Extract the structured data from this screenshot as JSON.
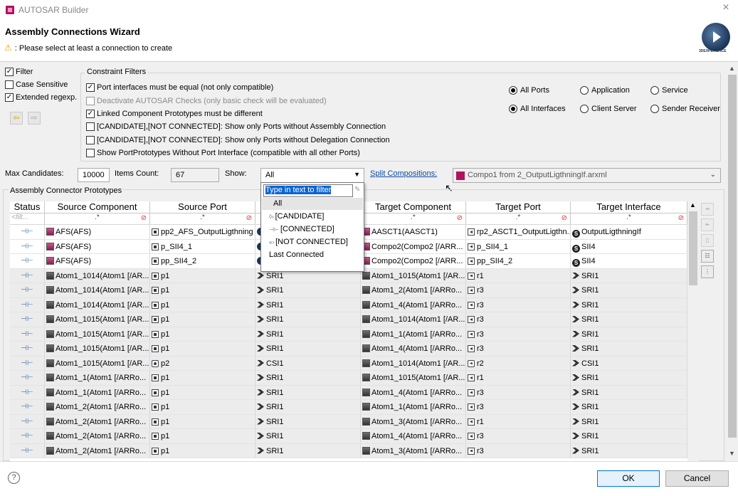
{
  "window": {
    "title": "AUTOSAR Builder",
    "close": "×"
  },
  "wizard": {
    "title": "Assembly Connections Wizard",
    "message": ": Please select at least a connection to create"
  },
  "brand": {
    "logo_text": "3DEXPERIENCE"
  },
  "left_options": {
    "filter": "Filter",
    "case_sensitive": "Case Sensitive",
    "extended_regexp": "Extended regexp."
  },
  "constraints": {
    "group_label": "Constraint Filters",
    "items": [
      "Port interfaces must be equal (not only compatible)",
      "Deactivate AUTOSAR Checks (only basic check will be evaluated)",
      "Linked Component Prototypes must be different",
      "[CANDIDATE],[NOT CONNECTED]: Show only Ports without Assembly Connection",
      "[CANDIDATE],[NOT CONNECTED]: Show only Ports without Delegation Connection",
      "Show PortPrototypes Without Port Interface (compatible with all other Ports)"
    ],
    "ports_radios": [
      "All Ports",
      "Application",
      "Service"
    ],
    "interfaces_radios": [
      "All Interfaces",
      "Client Server",
      "Sender Receiver"
    ]
  },
  "controls": {
    "max_candidates_label": "Max Candidates:",
    "max_candidates_value": "10000",
    "items_count_label": "Items Count:",
    "items_count_value": "67",
    "show_label": "Show:",
    "show_value": "All",
    "split_link": "Split Compositions:",
    "composition_value": "Compo1 from 2_OutputLigthningIf.arxml"
  },
  "dropdown": {
    "placeholder": "Type in text to filter",
    "items": [
      "All",
      "[CANDIDATE]",
      "[CONNECTED]",
      "[NOT CONNECTED]",
      "Last Connected"
    ]
  },
  "table": {
    "group_label": "Assembly Connector Prototypes",
    "columns": [
      "Status",
      "Source Component",
      "Source Port",
      "",
      "Target Component",
      "Target Port",
      "Target Interface"
    ],
    "filters": [
      "<filt...",
      ".*",
      ".*",
      "",
      ".*",
      ".*",
      ".*"
    ],
    "rows": [
      {
        "src_comp": "AFS(AFS)",
        "src_port": "pp2_AFS_OutputLigthning",
        "iface": "",
        "tgt_comp": "AASCT1(AASCT1)",
        "tgt_port": "rp2_ASCT1_OutputLigthn...",
        "tgt_iface": "OutputLigthningIf"
      },
      {
        "src_comp": "AFS(AFS)",
        "src_port": "p_SII4_1",
        "iface": "",
        "tgt_comp": "Compo2(Compo2 [/ARR...",
        "tgt_port": "p_SII4_1",
        "tgt_iface": "SII4"
      },
      {
        "src_comp": "AFS(AFS)",
        "src_port": "pp_SII4_2",
        "iface": "",
        "tgt_comp": "Compo2(Compo2 [/ARR...",
        "tgt_port": "pp_SII4_2",
        "tgt_iface": "SII4"
      },
      {
        "src_comp": "Atom1_1014(Atom1 [/AR...",
        "src_port": "p1",
        "iface": "SRI1",
        "tgt_comp": "Atom1_1015(Atom1 [/AR...",
        "tgt_port": "r1",
        "tgt_iface": "SRI1"
      },
      {
        "src_comp": "Atom1_1014(Atom1 [/AR...",
        "src_port": "p1",
        "iface": "SRI1",
        "tgt_comp": "Atom1_2(Atom1 [/ARRo...",
        "tgt_port": "r3",
        "tgt_iface": "SRI1"
      },
      {
        "src_comp": "Atom1_1014(Atom1 [/AR...",
        "src_port": "p1",
        "iface": "SRI1",
        "tgt_comp": "Atom1_4(Atom1 [/ARRo...",
        "tgt_port": "r3",
        "tgt_iface": "SRI1"
      },
      {
        "src_comp": "Atom1_1015(Atom1 [/AR...",
        "src_port": "p1",
        "iface": "SRI1",
        "tgt_comp": "Atom1_1014(Atom1 [/AR...",
        "tgt_port": "r3",
        "tgt_iface": "SRI1"
      },
      {
        "src_comp": "Atom1_1015(Atom1 [/AR...",
        "src_port": "p1",
        "iface": "SRI1",
        "tgt_comp": "Atom1_1(Atom1 [/ARRo...",
        "tgt_port": "r3",
        "tgt_iface": "SRI1"
      },
      {
        "src_comp": "Atom1_1015(Atom1 [/AR...",
        "src_port": "p1",
        "iface": "SRI1",
        "tgt_comp": "Atom1_4(Atom1 [/ARRo...",
        "tgt_port": "r3",
        "tgt_iface": "SRI1"
      },
      {
        "src_comp": "Atom1_1015(Atom1 [/AR...",
        "src_port": "p2",
        "iface": "CSI1",
        "tgt_comp": "Atom1_1014(Atom1 [/AR...",
        "tgt_port": "r2",
        "tgt_iface": "CSI1"
      },
      {
        "src_comp": "Atom1_1(Atom1 [/ARRo...",
        "src_port": "p1",
        "iface": "SRI1",
        "tgt_comp": "Atom1_1015(Atom1 [/AR...",
        "tgt_port": "r1",
        "tgt_iface": "SRI1"
      },
      {
        "src_comp": "Atom1_1(Atom1 [/ARRo...",
        "src_port": "p1",
        "iface": "SRI1",
        "tgt_comp": "Atom1_4(Atom1 [/ARRo...",
        "tgt_port": "r3",
        "tgt_iface": "SRI1"
      },
      {
        "src_comp": "Atom1_2(Atom1 [/ARRo...",
        "src_port": "p1",
        "iface": "SRI1",
        "tgt_comp": "Atom1_1(Atom1 [/ARRo...",
        "tgt_port": "r3",
        "tgt_iface": "SRI1"
      },
      {
        "src_comp": "Atom1_2(Atom1 [/ARRo...",
        "src_port": "p1",
        "iface": "SRI1",
        "tgt_comp": "Atom1_3(Atom1 [/ARRo...",
        "tgt_port": "r1",
        "tgt_iface": "SRI1"
      },
      {
        "src_comp": "Atom1_2(Atom1 [/ARRo...",
        "src_port": "p1",
        "iface": "SRI1",
        "tgt_comp": "Atom1_4(Atom1 [/ARRo...",
        "tgt_port": "r3",
        "tgt_iface": "SRI1"
      },
      {
        "src_comp": "Atom1_2(Atom1 [/ARRo...",
        "src_port": "p1",
        "iface": "SRI1",
        "tgt_comp": "Atom1_3(Atom1 [/ARRo...",
        "tgt_port": "r3",
        "tgt_iface": "SRI1"
      }
    ]
  },
  "footer": {
    "help": "?",
    "ok": "OK",
    "cancel": "Cancel"
  }
}
